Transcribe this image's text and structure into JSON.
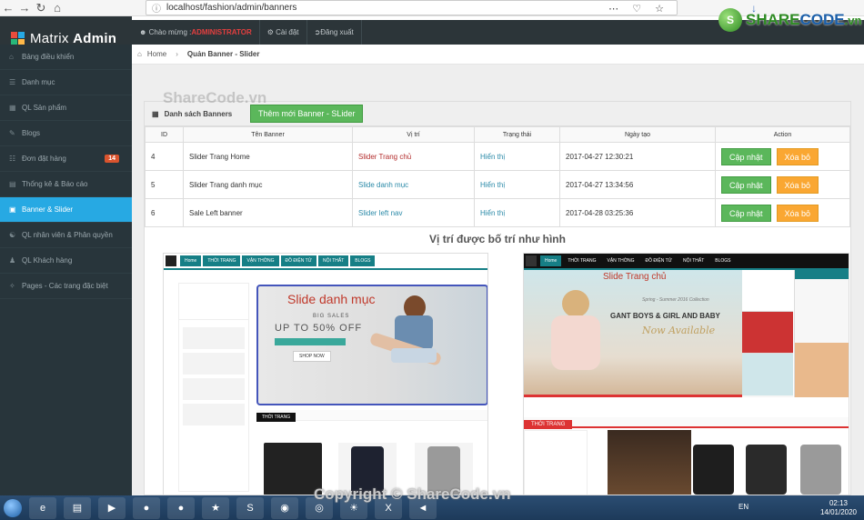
{
  "browser": {
    "url": "localhost/fashion/admin/banners",
    "icons": [
      "back-icon",
      "forward-icon",
      "reload-icon",
      "home-icon"
    ]
  },
  "brand": {
    "text_a": "SHARE",
    "text_b": "CODE",
    "suffix": ".vn"
  },
  "topbar": {
    "logo_a": "Matrix ",
    "logo_b": "Admin",
    "greet": "Chào mừng : ",
    "user": "ADMINISTRATOR",
    "settings": "Cài đặt",
    "logout": "Đăng xuất"
  },
  "sidebar": {
    "items": [
      {
        "label": "Bảng điều khiển"
      },
      {
        "label": "Danh mục"
      },
      {
        "label": "QL Sản phẩm"
      },
      {
        "label": "Blogs"
      },
      {
        "label": "Đơn đặt hàng",
        "badge": "14"
      },
      {
        "label": "Thống kê & Báo cáo"
      },
      {
        "label": "Banner & Slider"
      },
      {
        "label": "QL nhân viên & Phân quyền"
      },
      {
        "label": "QL Khách hàng"
      },
      {
        "label": "Pages - Các trang đặc biệt"
      }
    ]
  },
  "breadcrumb": {
    "home": "Home",
    "current": "Quản Banner - Slider"
  },
  "panel": {
    "title": "Danh sách Banners",
    "add_button": "Thêm mới Banner - SLider",
    "watermark": "ShareCode.vn"
  },
  "table": {
    "headers": [
      "ID",
      "Tên Banner",
      "Vị trí",
      "Trạng thái",
      "Ngày tạo",
      "Action"
    ],
    "rows": [
      {
        "id": "4",
        "name": "Slider Trang Home",
        "pos": "Slider Trang chủ",
        "status": "Hiển thị",
        "date": "2017-04-27 12:30:21"
      },
      {
        "id": "5",
        "name": "Slider Trang danh mục",
        "pos": "Slide danh mục",
        "status": "Hiển thị",
        "date": "2017-04-27 13:34:56"
      },
      {
        "id": "6",
        "name": "Sale Left banner",
        "pos": "Slider left nav",
        "status": "Hiển thị",
        "date": "2017-04-28 03:25:36"
      }
    ],
    "update_label": "Cập nhật",
    "delete_label": "Xóa bỏ"
  },
  "section_title": "Vị trí được bố trí như hình",
  "shots": {
    "left_label": "Slide danh mục",
    "left_sale": "UP TO 50% OFF",
    "left_big": "BIG SALES",
    "left_shop": "SHOP NOW",
    "right_label": "Slide Trang chủ",
    "right_headline": "GANT BOYS & GIRL AND BABY",
    "right_sub": "Now Available",
    "right_tagline": "Spring - Summer 2016 Collection",
    "fashion_tab": "THỜI TRANG",
    "nav_items": [
      "Home",
      "THỜI TRANG",
      "VẬN THỜNG",
      "ĐỒ ĐIỆN TỬ",
      "NỘI THẤT",
      "BLOGS"
    ]
  },
  "taskbar": {
    "lang": "EN",
    "time": "02:13",
    "date": "14/01/2020"
  },
  "copyright": "Copyright © ShareCode.vn"
}
